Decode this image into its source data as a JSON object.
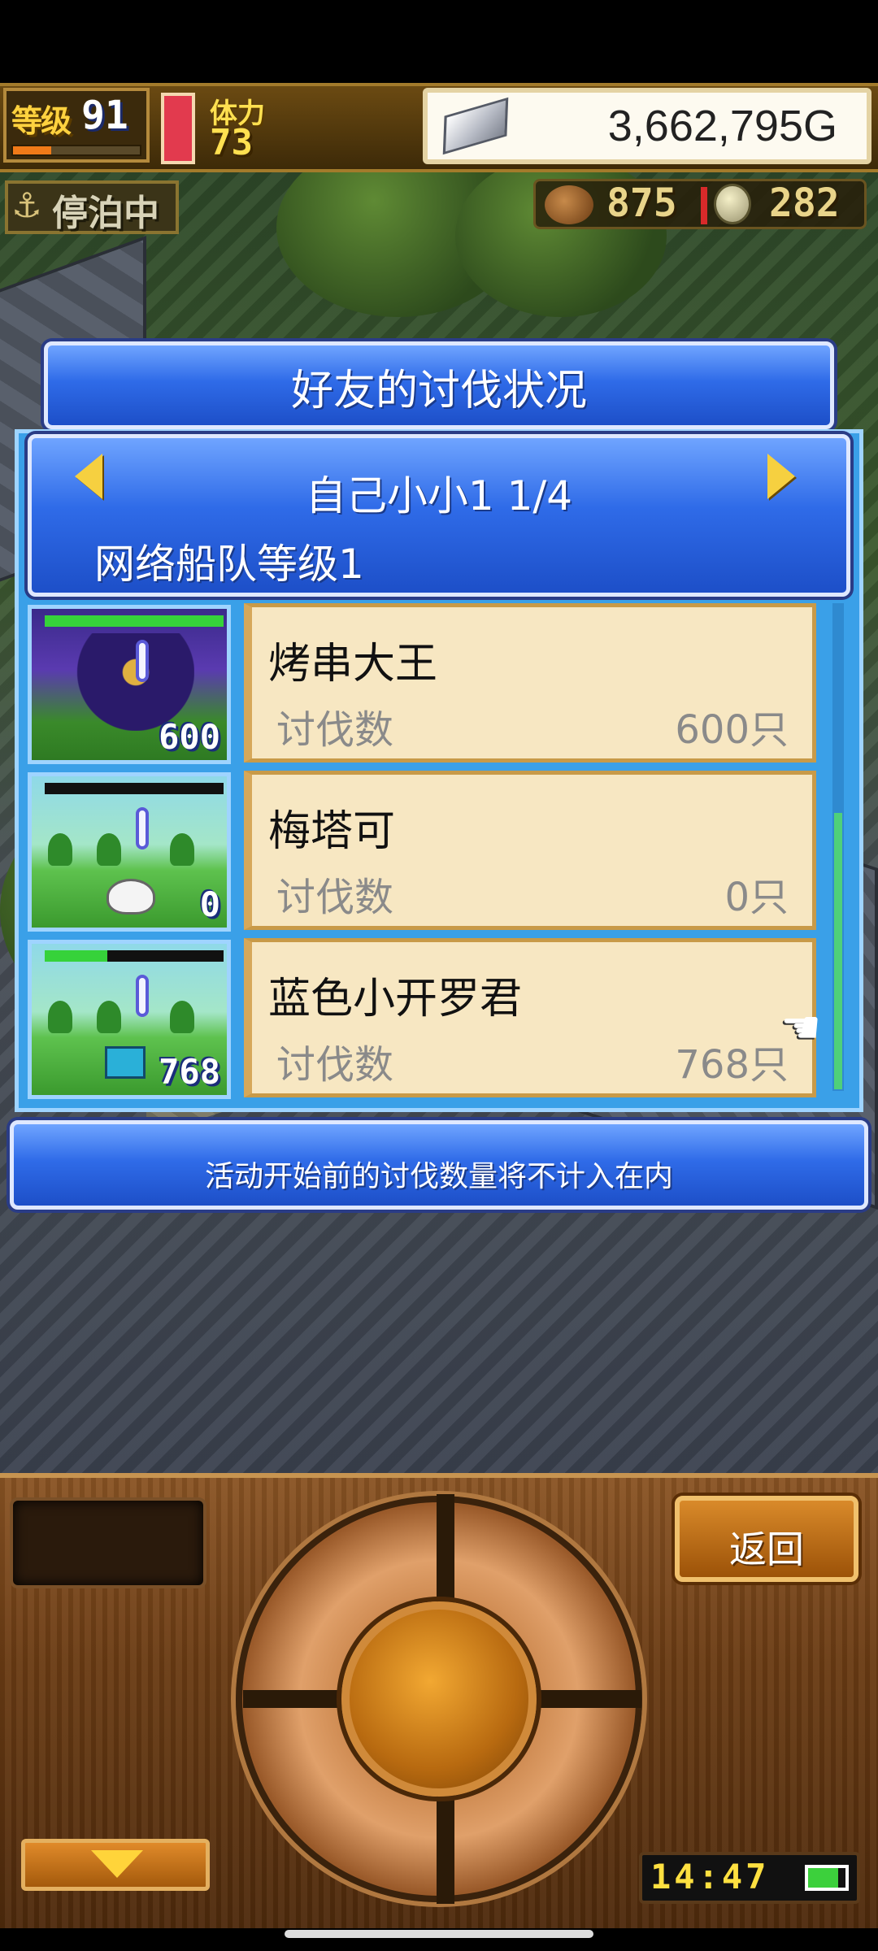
{
  "hud": {
    "level_label": "等级",
    "level_value": "91",
    "xp_fraction": 0.3,
    "stamina_label": "体力",
    "stamina_value": "73",
    "gold_value": "3,662,795G",
    "status_label": "停泊中",
    "resource1_value": "875",
    "resource2_value": "282"
  },
  "dialog": {
    "title": "好友的讨伐状况",
    "friend_name": "自己小小1 1/4",
    "fleet_level": "网络船队等级1",
    "rows": [
      {
        "name": "烤串大王",
        "label": "讨伐数",
        "value": "600只",
        "badge": "600",
        "hp_fraction": 1.0
      },
      {
        "name": "梅塔可",
        "label": "讨伐数",
        "value": "0只",
        "badge": "0",
        "hp_fraction": 0.0
      },
      {
        "name": "蓝色小开罗君",
        "label": "讨伐数",
        "value": "768只",
        "badge": "768",
        "hp_fraction": 0.35
      }
    ],
    "note": "活动开始前的讨伐数量将不计入在内"
  },
  "controls": {
    "back_label": "返回",
    "clock": "14:47"
  },
  "colors": {
    "panel_blue": "#2f6be8",
    "card_bg": "#f7e7c2",
    "accent_gold": "#f6d040"
  },
  "icons": {
    "anchor": "anchor-icon",
    "gold": "silver-bar-icon",
    "pointer": "hand-pointer-icon"
  }
}
